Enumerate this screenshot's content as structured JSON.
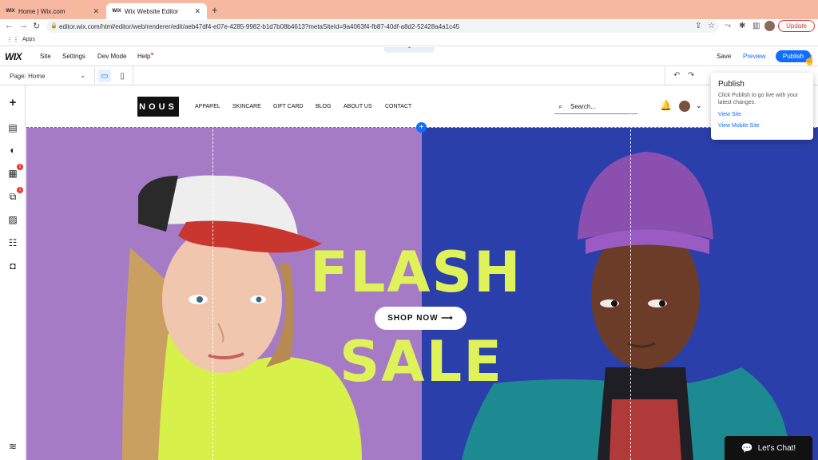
{
  "browser": {
    "tabs": [
      {
        "title": "Home | Wix.com",
        "favicon": "WIX"
      },
      {
        "title": "Wix Website Editor",
        "favicon": "WIX"
      }
    ],
    "url": "editor.wix.com/html/editor/web/renderer/edit/aeb47df4-e07e-4285-9982-b1d7b08b4613?metaSiteId=9a4063f4-fb87-40df-a8d2-52428a4a1c45",
    "update_label": "Update",
    "bookmarks_label": "Apps"
  },
  "wix_bar": {
    "logo": "WIX",
    "menu": [
      "Site",
      "Settings",
      "Dev Mode",
      "Help"
    ],
    "save_label": "Save",
    "preview_label": "Preview",
    "publish_label": "Publish"
  },
  "sub_bar": {
    "page_label": "Page: Home"
  },
  "site": {
    "logo": "NOUS",
    "nav": [
      "APPAREL",
      "SKINCARE",
      "GIFT CARD",
      "BLOG",
      "ABOUT US",
      "CONTACT"
    ],
    "search_placeholder": "Search...",
    "headline_1": "FLASH",
    "headline_2": "SALE",
    "cta_label": "SHOP NOW ⟶"
  },
  "left_badges": [
    "2",
    "1"
  ],
  "publish_popup": {
    "title": "Publish",
    "description": "Click Publish to go live with your latest changes.",
    "link_1": "View Site",
    "link_2": "View Mobile Site"
  },
  "chat": {
    "label": "Let's Chat!"
  },
  "colors": {
    "tab_strip": "#f6b8a0",
    "wix_blue": "#116dff",
    "hero_left": "#a67bc6",
    "hero_right": "#2b3faa",
    "headline": "#dff25a"
  }
}
